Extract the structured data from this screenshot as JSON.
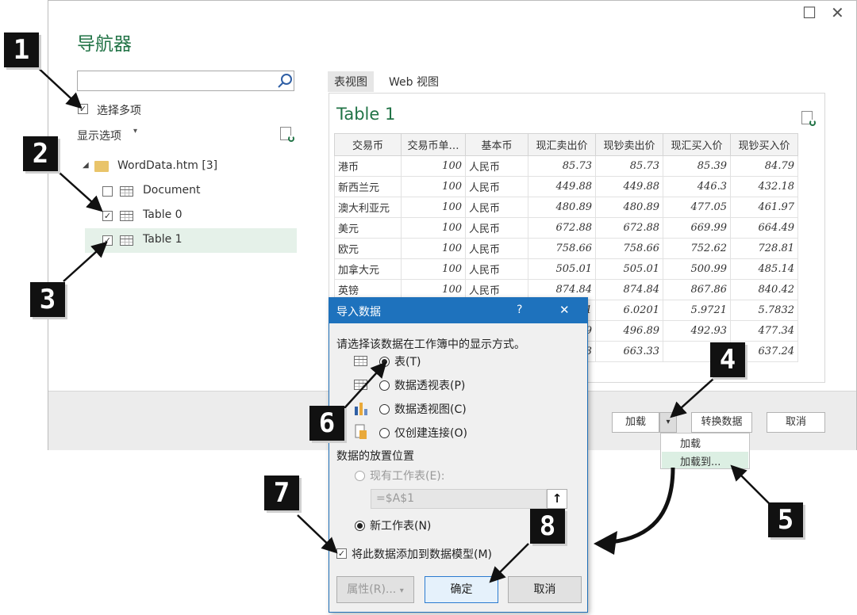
{
  "window": {
    "title": "导航器",
    "maximize_glyph": "☐",
    "close_glyph": "✕"
  },
  "left": {
    "search": {
      "value": "",
      "placeholder": ""
    },
    "select_multiple": {
      "label": "选择多项",
      "checked": true
    },
    "display_options": "显示选项",
    "tree": {
      "root": "WordData.htm [3]",
      "items": [
        {
          "label": "Document",
          "checked": false
        },
        {
          "label": "Table 0",
          "checked": true
        },
        {
          "label": "Table 1",
          "checked": true,
          "selected": true
        }
      ]
    }
  },
  "preview": {
    "tabs": [
      "表视图",
      "Web 视图"
    ],
    "table_title": "Table 1",
    "columns": [
      "交易币",
      "交易币单…",
      "基本币",
      "现汇卖出价",
      "现钞卖出价",
      "现汇买入价",
      "现钞买入价"
    ],
    "rows": [
      [
        "港币",
        "100",
        "人民币",
        "85.73",
        "85.73",
        "85.39",
        "84.79"
      ],
      [
        "新西兰元",
        "100",
        "人民币",
        "449.88",
        "449.88",
        "446.3",
        "432.18"
      ],
      [
        "澳大利亚元",
        "100",
        "人民币",
        "480.89",
        "480.89",
        "477.05",
        "461.97"
      ],
      [
        "美元",
        "100",
        "人民币",
        "672.88",
        "672.88",
        "669.99",
        "664.49"
      ],
      [
        "欧元",
        "100",
        "人民币",
        "758.66",
        "758.66",
        "752.62",
        "728.81"
      ],
      [
        "加拿大元",
        "100",
        "人民币",
        "505.01",
        "505.01",
        "500.99",
        "485.14"
      ],
      [
        "英镑",
        "100",
        "人民币",
        "874.84",
        "874.84",
        "867.86",
        "840.42"
      ],
      [
        "",
        "",
        "",
        "01",
        "6.0201",
        "5.9721",
        "5.7832"
      ],
      [
        "",
        "",
        "",
        "39",
        "496.89",
        "492.93",
        "477.34"
      ],
      [
        "",
        "",
        "",
        "33",
        "663.33",
        "6",
        "637.24"
      ]
    ]
  },
  "footer": {
    "load": "加载",
    "transform": "转换数据",
    "cancel": "取消",
    "menu": [
      "加载",
      "加载到..."
    ]
  },
  "dialog": {
    "title": "导入数据",
    "help": "?",
    "close": "✕",
    "prompt": "请选择该数据在工作簿中的显示方式。",
    "view_options": [
      "表(T)",
      "数据透视表(P)",
      "数据透视图(C)",
      "仅创建连接(O)"
    ],
    "location_label": "数据的放置位置",
    "existing": "现有工作表(E):",
    "cell_ref": "=$A$1",
    "new_sheet": "新工作表(N)",
    "add_model": "将此数据添加到数据模型(M)",
    "properties": "属性(R)...",
    "ok": "确定",
    "cancel": "取消"
  },
  "callouts": [
    "1",
    "2",
    "3",
    "4",
    "5",
    "6",
    "7",
    "8"
  ],
  "colors": {
    "accent_green": "#217346",
    "dialog_blue": "#1e72bd",
    "selected_row": "#e5f1e9",
    "menu_hover": "#dcefe3"
  }
}
